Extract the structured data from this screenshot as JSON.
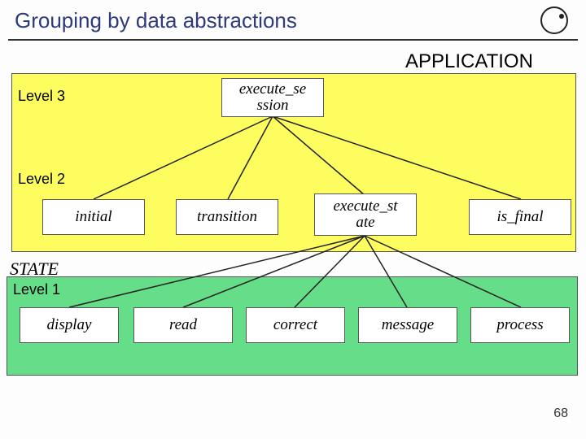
{
  "title": "Grouping by data abstractions",
  "labels": {
    "application": "APPLICATION",
    "state": "STATE",
    "level3": "Level 3",
    "level2": "Level 2",
    "level1": "Level 1"
  },
  "nodes": {
    "execute_session": "execute_se\nssion",
    "initial": "initial",
    "transition": "transition",
    "execute_state": "execute_st\nate",
    "is_final": "is_final",
    "display": "display",
    "read": "read",
    "correct": "correct",
    "message": "message",
    "process": "process"
  },
  "pagenum": "68"
}
